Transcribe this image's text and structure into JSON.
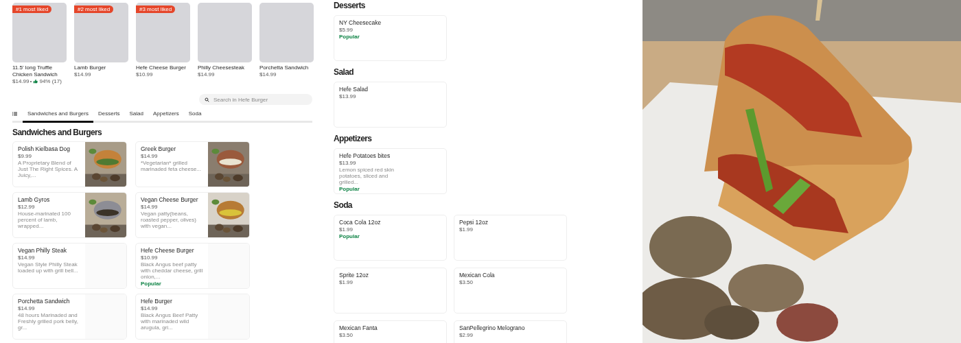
{
  "featured": [
    {
      "badge": "#1 most liked",
      "name": "11.5' long Truffle Chicken Sandwich",
      "price": "$14.99",
      "rating": "94% (17)"
    },
    {
      "badge": "#2 most liked",
      "name": "Lamb Burger",
      "price": "$14.99"
    },
    {
      "badge": "#3 most liked",
      "name": "Hefe Cheese Burger",
      "price": "$10.99"
    },
    {
      "name": "Philly Cheesesteak",
      "price": "$14.99"
    },
    {
      "name": "Porchetta Sandwich",
      "price": "$14.99"
    }
  ],
  "search": {
    "placeholder": "Search in Hefe Burger"
  },
  "tabs": [
    {
      "label": "Sandwiches and Burgers",
      "selected": true
    },
    {
      "label": "Desserts",
      "selected": false
    },
    {
      "label": "Salad",
      "selected": false
    },
    {
      "label": "Appetizers",
      "selected": false
    },
    {
      "label": "Soda",
      "selected": false
    }
  ],
  "sections": [
    {
      "title": "Sandwiches and Burgers",
      "items": [
        {
          "name": "Polish Kielbasa Dog",
          "price": "$9.99",
          "description": "A Proprietary Blend of Just The Right Spices. A Juicy,...",
          "has_photo": true
        },
        {
          "name": "Greek Burger",
          "price": "$14.99",
          "description": "*Vegetarian* grilled marinaded feta cheese...",
          "has_photo": true
        },
        {
          "name": "Lamb Gyros",
          "price": "$12.99",
          "description": "House-marinated 100 percent of lamb, wrapped...",
          "has_photo": true
        },
        {
          "name": "Vegan Cheese Burger",
          "price": "$14.99",
          "description": "Vegan patty(beans, roasted pepper, olives) with vegan...",
          "has_photo": true
        },
        {
          "name": "Vegan Philly Steak",
          "price": "$14.99",
          "description": "Vegan Style Philly Steak loaded up with grill bell...",
          "has_photo": false
        },
        {
          "name": "Hefe Cheese Burger",
          "price": "$10.99",
          "description": "Black Angus beef patty with cheddar cheese, grill onion,...",
          "popular": "Popular",
          "has_photo": false
        },
        {
          "name": "Porchetta Sandwich",
          "price": "$14.99",
          "description": "48 hours Marinaded and Freshly grilled pork belly, gr...",
          "has_photo": false
        },
        {
          "name": "Hefe Burger",
          "price": "$14.99",
          "description": "Black Angus Beef Patty with marinaded wild arugula, gri...",
          "has_photo": false
        }
      ]
    },
    {
      "title": "Desserts",
      "items": [
        {
          "name": "NY Cheesecake",
          "price": "$5.99",
          "popular": "Popular"
        }
      ]
    },
    {
      "title": "Salad",
      "items": [
        {
          "name": "Hefe Salad",
          "price": "$13.99"
        }
      ]
    },
    {
      "title": "Appetizers",
      "items": [
        {
          "name": "Hefe Potatoes bites",
          "price": "$13.99",
          "description": "Lemon spiced red skin potatoes, sliced and grilled...",
          "popular": "Popular"
        }
      ]
    },
    {
      "title": "Soda",
      "items": [
        {
          "name": "Coca Cola 12oz",
          "price": "$1.99",
          "popular": "Popular"
        },
        {
          "name": "Pepsi 12oz",
          "price": "$1.99"
        },
        {
          "name": "Sprite 12oz",
          "price": "$1.99"
        },
        {
          "name": "Mexican Cola",
          "price": "$3.50"
        },
        {
          "name": "Mexican Fanta",
          "price": "$3.50"
        },
        {
          "name": "SanPellegrino Melograno",
          "price": "$2.99"
        }
      ]
    }
  ]
}
